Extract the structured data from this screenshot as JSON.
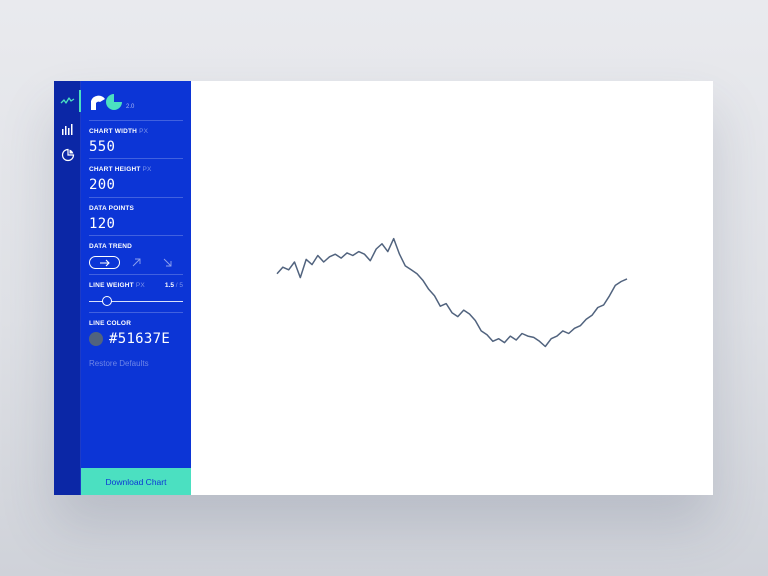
{
  "app": {
    "version": "2.0"
  },
  "nav": {
    "items": [
      {
        "icon": "line-chart-icon",
        "active": true
      },
      {
        "icon": "bar-chart-icon",
        "active": false
      },
      {
        "icon": "pie-chart-icon",
        "active": false
      }
    ]
  },
  "settings": {
    "chart_width": {
      "label": "CHART WIDTH",
      "unit": "PX",
      "value": "550"
    },
    "chart_height": {
      "label": "CHART HEIGHT",
      "unit": "PX",
      "value": "200"
    },
    "data_points": {
      "label": "DATA POINTS",
      "value": "120"
    },
    "data_trend": {
      "label": "DATA TREND",
      "options": [
        {
          "icon": "arrow-right-icon",
          "selected": true
        },
        {
          "icon": "arrow-up-right-icon",
          "selected": false
        },
        {
          "icon": "arrow-down-right-icon",
          "selected": false
        }
      ]
    },
    "line_weight": {
      "label": "LINE WEIGHT",
      "unit": "PX",
      "value": "1.5",
      "max": "/ 5",
      "fraction": 0.16
    },
    "line_color": {
      "label": "LINE COLOR",
      "value": "#51637E",
      "hex": "#51637e"
    },
    "restore_label": "Restore Defaults"
  },
  "download_label": "Download Chart",
  "colors": {
    "sidebar": "#0c35d6",
    "iconbar": "#0b27a6",
    "accent": "#4be0c1",
    "line": "#51637e"
  },
  "chart_data": {
    "type": "line",
    "title": "",
    "xlabel": "",
    "ylabel": "",
    "xlim": [
      0,
      120
    ],
    "ylim": [
      0,
      100
    ],
    "series": [
      {
        "x": [
          0,
          2,
          4,
          6,
          8,
          10,
          12,
          14,
          16,
          18,
          20,
          22,
          24,
          26,
          28,
          30,
          32,
          34,
          36,
          38,
          40,
          42,
          44,
          46,
          48,
          50,
          52,
          54,
          56,
          58,
          60,
          62,
          64,
          66,
          68,
          70,
          72,
          74,
          76,
          78,
          80,
          82,
          84,
          86,
          88,
          90,
          92,
          94,
          96,
          98,
          100,
          102,
          104,
          106,
          108,
          110,
          112,
          114,
          116,
          118,
          120
        ],
        "values": [
          61,
          66,
          64,
          70,
          58,
          72,
          68,
          75,
          70,
          74,
          76,
          73,
          77,
          75,
          78,
          76,
          71,
          80,
          84,
          78,
          88,
          76,
          67,
          64,
          61,
          56,
          49,
          44,
          36,
          38,
          31,
          28,
          33,
          30,
          25,
          17,
          14,
          9,
          11,
          8,
          13,
          10,
          15,
          13,
          12,
          9,
          5,
          11,
          13,
          17,
          15,
          19,
          21,
          26,
          29,
          35,
          37,
          44,
          52,
          55,
          57
        ]
      }
    ]
  }
}
